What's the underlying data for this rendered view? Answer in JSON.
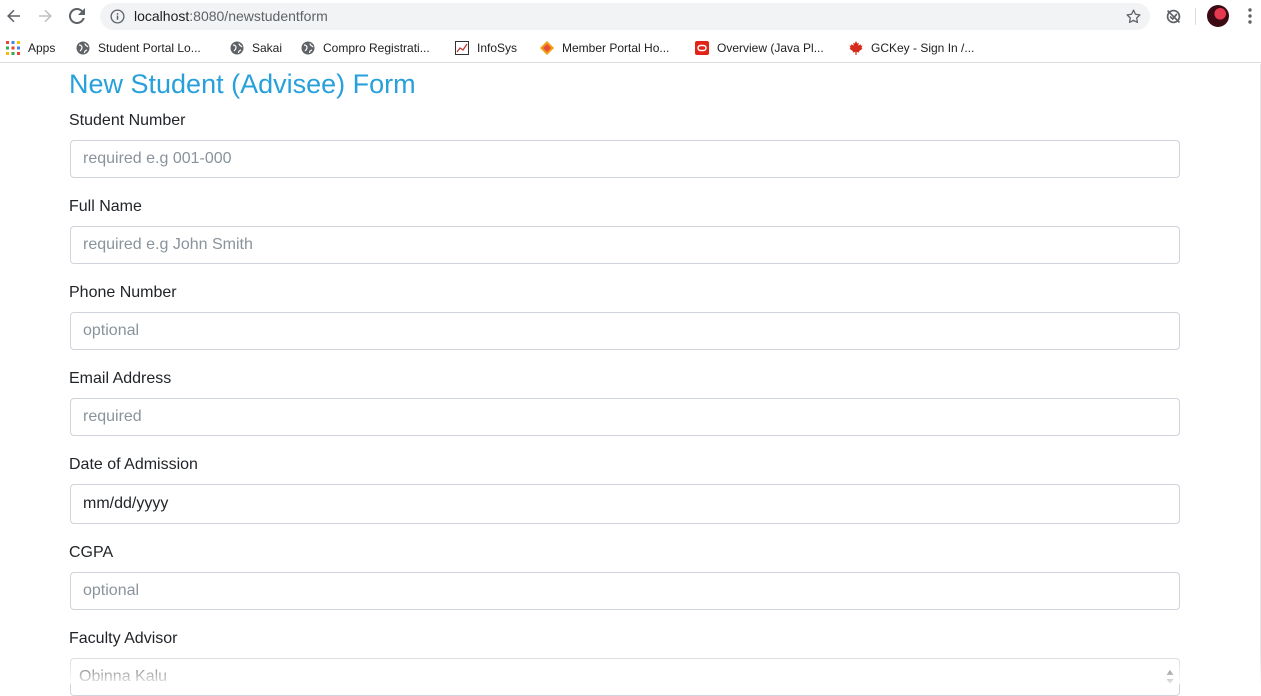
{
  "browser": {
    "url_host": "localhost",
    "url_rest": ":8080/newstudentform",
    "bookmarks": [
      {
        "label": "Apps",
        "icon": "apps-grid-icon"
      },
      {
        "label": "Student Portal Lo...",
        "icon": "globe-icon"
      },
      {
        "label": "Sakai",
        "icon": "globe-icon"
      },
      {
        "label": "Compro Registrati...",
        "icon": "globe-icon"
      },
      {
        "label": "InfoSys",
        "icon": "chart-icon"
      },
      {
        "label": "Member Portal Ho...",
        "icon": "diamond-icon"
      },
      {
        "label": "Overview (Java Pl...",
        "icon": "oracle-icon"
      },
      {
        "label": "GCKey - Sign In /...",
        "icon": "maple-leaf-icon"
      }
    ]
  },
  "form": {
    "title": "New Student (Advisee) Form",
    "fields": [
      {
        "label": "Student Number",
        "placeholder": "required e.g 001-000"
      },
      {
        "label": "Full Name",
        "placeholder": "required e.g John Smith"
      },
      {
        "label": "Phone Number",
        "placeholder": "optional"
      },
      {
        "label": "Email Address",
        "placeholder": "required"
      },
      {
        "label": "Date of Admission",
        "value": "mm/dd/yyyy"
      },
      {
        "label": "CGPA",
        "placeholder": "optional"
      },
      {
        "label": "Faculty Advisor",
        "value": "Obinna Kalu"
      }
    ]
  },
  "colors": {
    "title": "#27a0dc",
    "input_border": "#ced4da"
  }
}
